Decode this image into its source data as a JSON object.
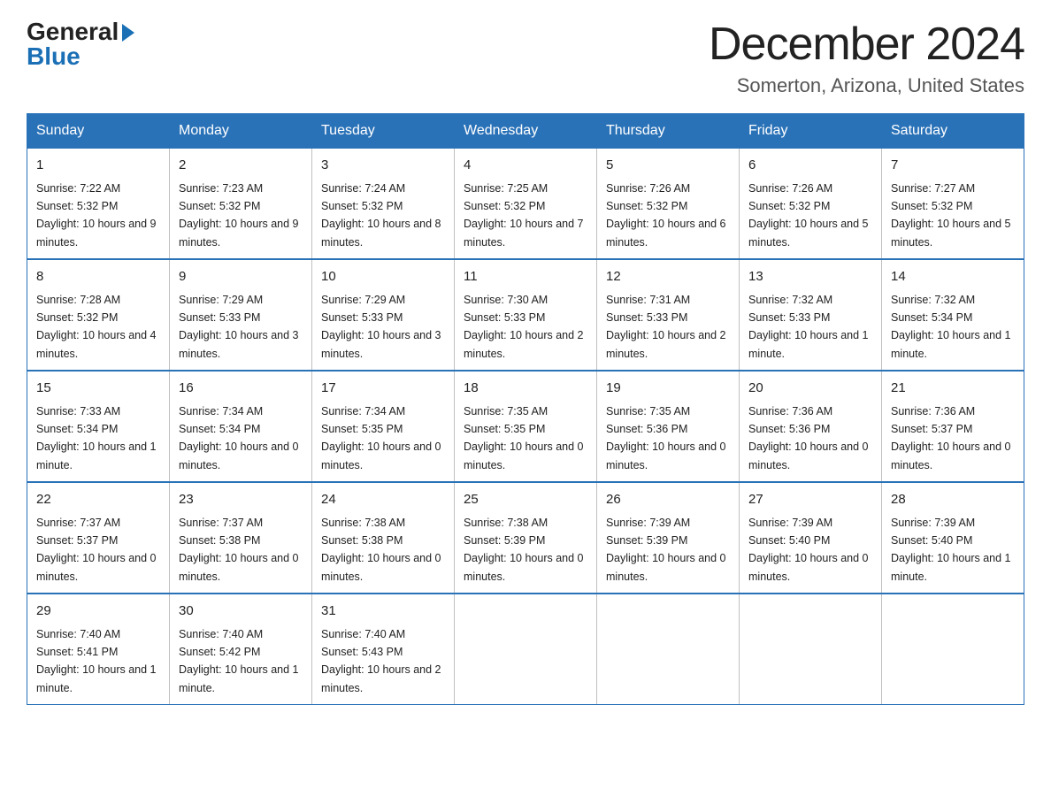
{
  "header": {
    "logo_general": "General",
    "logo_blue": "Blue",
    "month_title": "December 2024",
    "location": "Somerton, Arizona, United States"
  },
  "days_of_week": [
    "Sunday",
    "Monday",
    "Tuesday",
    "Wednesday",
    "Thursday",
    "Friday",
    "Saturday"
  ],
  "weeks": [
    [
      {
        "day": "1",
        "sunrise": "7:22 AM",
        "sunset": "5:32 PM",
        "daylight": "10 hours and 9 minutes."
      },
      {
        "day": "2",
        "sunrise": "7:23 AM",
        "sunset": "5:32 PM",
        "daylight": "10 hours and 9 minutes."
      },
      {
        "day": "3",
        "sunrise": "7:24 AM",
        "sunset": "5:32 PM",
        "daylight": "10 hours and 8 minutes."
      },
      {
        "day": "4",
        "sunrise": "7:25 AM",
        "sunset": "5:32 PM",
        "daylight": "10 hours and 7 minutes."
      },
      {
        "day": "5",
        "sunrise": "7:26 AM",
        "sunset": "5:32 PM",
        "daylight": "10 hours and 6 minutes."
      },
      {
        "day": "6",
        "sunrise": "7:26 AM",
        "sunset": "5:32 PM",
        "daylight": "10 hours and 5 minutes."
      },
      {
        "day": "7",
        "sunrise": "7:27 AM",
        "sunset": "5:32 PM",
        "daylight": "10 hours and 5 minutes."
      }
    ],
    [
      {
        "day": "8",
        "sunrise": "7:28 AM",
        "sunset": "5:32 PM",
        "daylight": "10 hours and 4 minutes."
      },
      {
        "day": "9",
        "sunrise": "7:29 AM",
        "sunset": "5:33 PM",
        "daylight": "10 hours and 3 minutes."
      },
      {
        "day": "10",
        "sunrise": "7:29 AM",
        "sunset": "5:33 PM",
        "daylight": "10 hours and 3 minutes."
      },
      {
        "day": "11",
        "sunrise": "7:30 AM",
        "sunset": "5:33 PM",
        "daylight": "10 hours and 2 minutes."
      },
      {
        "day": "12",
        "sunrise": "7:31 AM",
        "sunset": "5:33 PM",
        "daylight": "10 hours and 2 minutes."
      },
      {
        "day": "13",
        "sunrise": "7:32 AM",
        "sunset": "5:33 PM",
        "daylight": "10 hours and 1 minute."
      },
      {
        "day": "14",
        "sunrise": "7:32 AM",
        "sunset": "5:34 PM",
        "daylight": "10 hours and 1 minute."
      }
    ],
    [
      {
        "day": "15",
        "sunrise": "7:33 AM",
        "sunset": "5:34 PM",
        "daylight": "10 hours and 1 minute."
      },
      {
        "day": "16",
        "sunrise": "7:34 AM",
        "sunset": "5:34 PM",
        "daylight": "10 hours and 0 minutes."
      },
      {
        "day": "17",
        "sunrise": "7:34 AM",
        "sunset": "5:35 PM",
        "daylight": "10 hours and 0 minutes."
      },
      {
        "day": "18",
        "sunrise": "7:35 AM",
        "sunset": "5:35 PM",
        "daylight": "10 hours and 0 minutes."
      },
      {
        "day": "19",
        "sunrise": "7:35 AM",
        "sunset": "5:36 PM",
        "daylight": "10 hours and 0 minutes."
      },
      {
        "day": "20",
        "sunrise": "7:36 AM",
        "sunset": "5:36 PM",
        "daylight": "10 hours and 0 minutes."
      },
      {
        "day": "21",
        "sunrise": "7:36 AM",
        "sunset": "5:37 PM",
        "daylight": "10 hours and 0 minutes."
      }
    ],
    [
      {
        "day": "22",
        "sunrise": "7:37 AM",
        "sunset": "5:37 PM",
        "daylight": "10 hours and 0 minutes."
      },
      {
        "day": "23",
        "sunrise": "7:37 AM",
        "sunset": "5:38 PM",
        "daylight": "10 hours and 0 minutes."
      },
      {
        "day": "24",
        "sunrise": "7:38 AM",
        "sunset": "5:38 PM",
        "daylight": "10 hours and 0 minutes."
      },
      {
        "day": "25",
        "sunrise": "7:38 AM",
        "sunset": "5:39 PM",
        "daylight": "10 hours and 0 minutes."
      },
      {
        "day": "26",
        "sunrise": "7:39 AM",
        "sunset": "5:39 PM",
        "daylight": "10 hours and 0 minutes."
      },
      {
        "day": "27",
        "sunrise": "7:39 AM",
        "sunset": "5:40 PM",
        "daylight": "10 hours and 0 minutes."
      },
      {
        "day": "28",
        "sunrise": "7:39 AM",
        "sunset": "5:40 PM",
        "daylight": "10 hours and 1 minute."
      }
    ],
    [
      {
        "day": "29",
        "sunrise": "7:40 AM",
        "sunset": "5:41 PM",
        "daylight": "10 hours and 1 minute."
      },
      {
        "day": "30",
        "sunrise": "7:40 AM",
        "sunset": "5:42 PM",
        "daylight": "10 hours and 1 minute."
      },
      {
        "day": "31",
        "sunrise": "7:40 AM",
        "sunset": "5:43 PM",
        "daylight": "10 hours and 2 minutes."
      },
      null,
      null,
      null,
      null
    ]
  ]
}
